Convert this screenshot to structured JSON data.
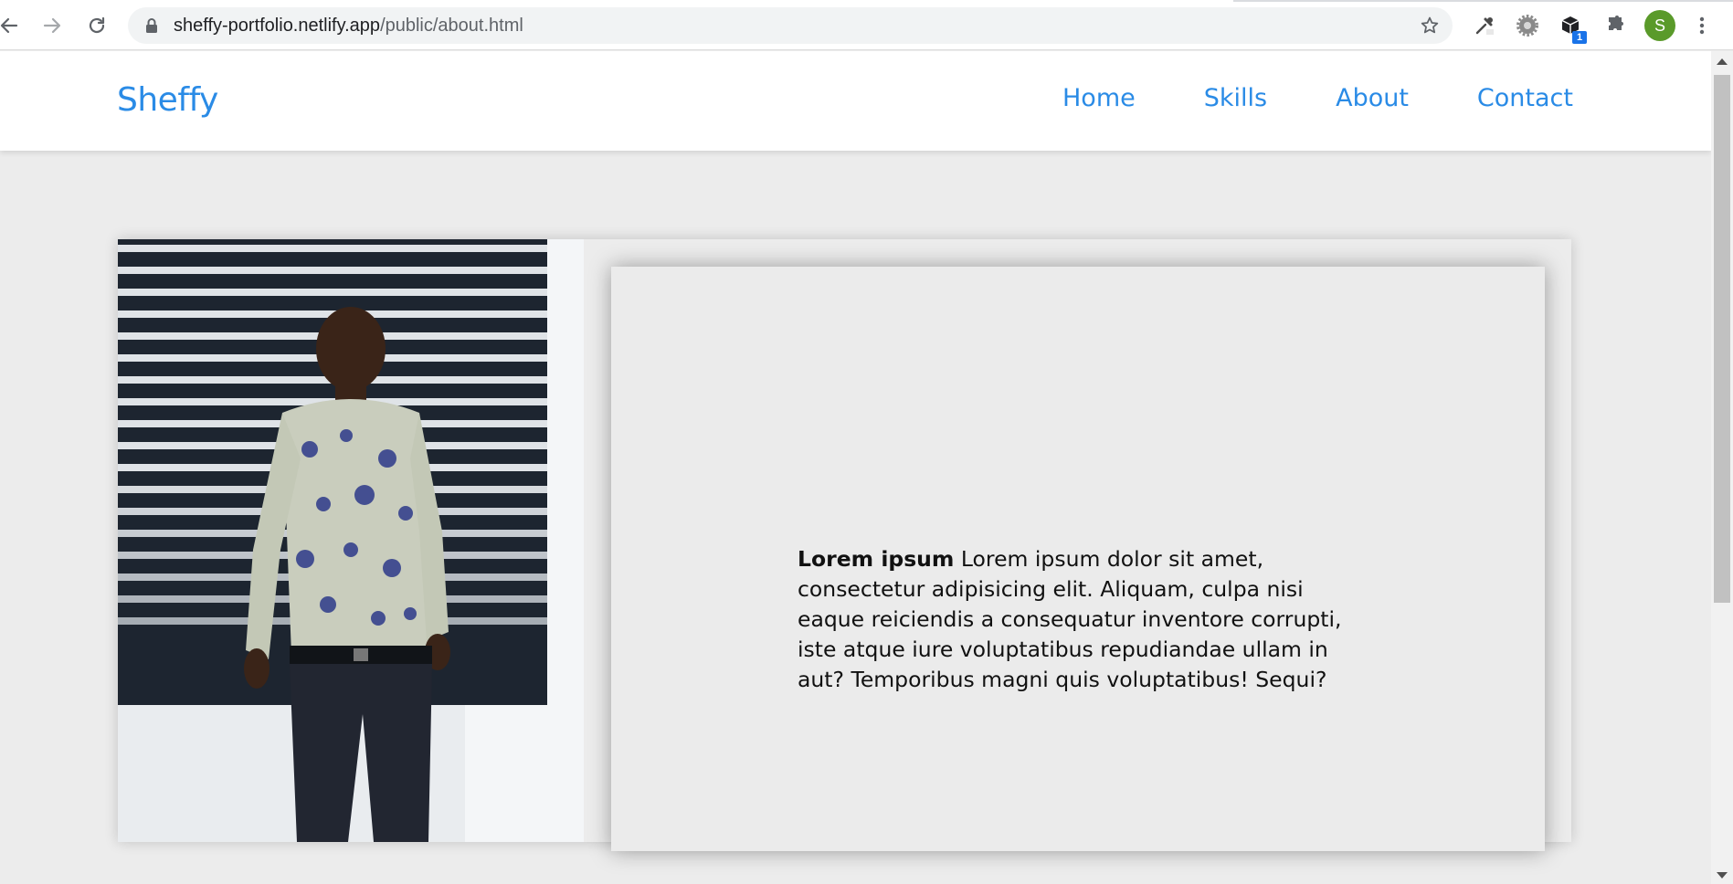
{
  "browser": {
    "url_host": "sheffy-portfolio.netlify.app",
    "url_path": "/public/about.html",
    "extension_badge": "1",
    "profile_initial": "S"
  },
  "site": {
    "brand": "Sheffy",
    "nav": [
      "Home",
      "Skills",
      "About",
      "Contact"
    ],
    "accent_color": "#2a8be6"
  },
  "about": {
    "lead": "Lorem ipsum",
    "body": " Lorem ipsum dolor sit amet, consectetur adipisicing elit. Aliquam, culpa nisi eaque reiciendis a consequatur inventore corrupti, iste atque iure voluptatibus repudiandae ullam in aut? Temporibus magni quis voluptatibus! Sequi?"
  }
}
